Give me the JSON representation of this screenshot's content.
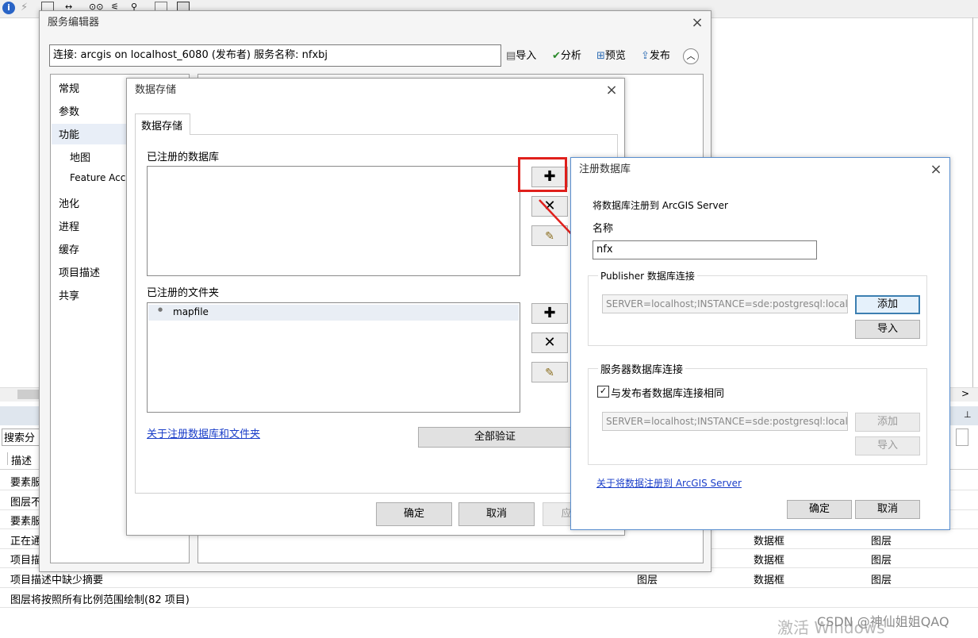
{
  "toolbar_bg": {
    "icons": [
      "info-icon",
      "lightning-icon",
      "table-icon",
      "arrows-icon",
      "binoculars-icon",
      "network-icon",
      "pin-icon",
      "window-icon",
      "save-icon"
    ]
  },
  "bg_panel": {
    "search_placeholder": "搜索分",
    "header_col1": "描述",
    "rows": [
      {
        "c1": "要素服",
        "c2": "",
        "c3": "",
        "c4": ""
      },
      {
        "c1": "图层不",
        "c2": "",
        "c3": "",
        "c4": ""
      },
      {
        "c1": "要素服",
        "c2": "",
        "c3": "",
        "c4": ""
      },
      {
        "c1": "正在通",
        "c2": "",
        "c3": "数据框",
        "c4": "图层"
      },
      {
        "c1": "项目描",
        "c2": "",
        "c3": "数据框",
        "c4": "图层"
      },
      {
        "c1": "项目描述中缺少摘要",
        "c2": "图层",
        "c3": "数据框",
        "c4": "图层"
      },
      {
        "c1": "图层将按照所有比例范围绘制(82 项目)",
        "c2": "",
        "c3": "",
        "c4": ""
      }
    ]
  },
  "service_editor": {
    "title": "服务编辑器",
    "connection": "连接: arcgis on localhost_6080 (发布者)   服务名称: nfxbj",
    "import_label": "导入",
    "analyze_label": "分析",
    "preview_label": "预览",
    "publish_label": "发布",
    "nav": [
      "常规",
      "参数",
      "功能",
      "地图",
      "Feature Acce",
      "池化",
      "进程",
      "缓存",
      "项目描述",
      "共享"
    ]
  },
  "data_store": {
    "title": "数据存储",
    "tab": "数据存储",
    "registered_db_label": "已注册的数据库",
    "registered_folder_label": "已注册的文件夹",
    "folders": [
      "mapfile"
    ],
    "about_link": "关于注册数据库和文件夹",
    "validate_all": "全部验证",
    "ok": "确定",
    "cancel": "取消",
    "apply": "应"
  },
  "register_db": {
    "title": "注册数据库",
    "intro": "将数据库注册到 ArcGIS Server",
    "name_label": "名称",
    "name_value": "nfx",
    "publisher_group": "Publisher 数据库连接",
    "publisher_conn": "SERVER=localhost;INSTANCE=sde:postgresql:localhost;I",
    "add": "添加",
    "import": "导入",
    "server_group": "服务器数据库连接",
    "same_as_publisher": "与发布者数据库连接相同",
    "server_conn": "SERVER=localhost;INSTANCE=sde:postgresql:localhost;I",
    "about_link": "关于将数据注册到 ArcGIS Server",
    "ok": "确定",
    "cancel": "取消"
  },
  "watermark": {
    "activate": "激活 Windows",
    "csdn": "CSDN @神仙姐姐QAQ"
  },
  "colors": {
    "highlight_red": "#e0201c",
    "link_blue": "#1a3ec9",
    "focus_blue": "#3c7fb1"
  }
}
